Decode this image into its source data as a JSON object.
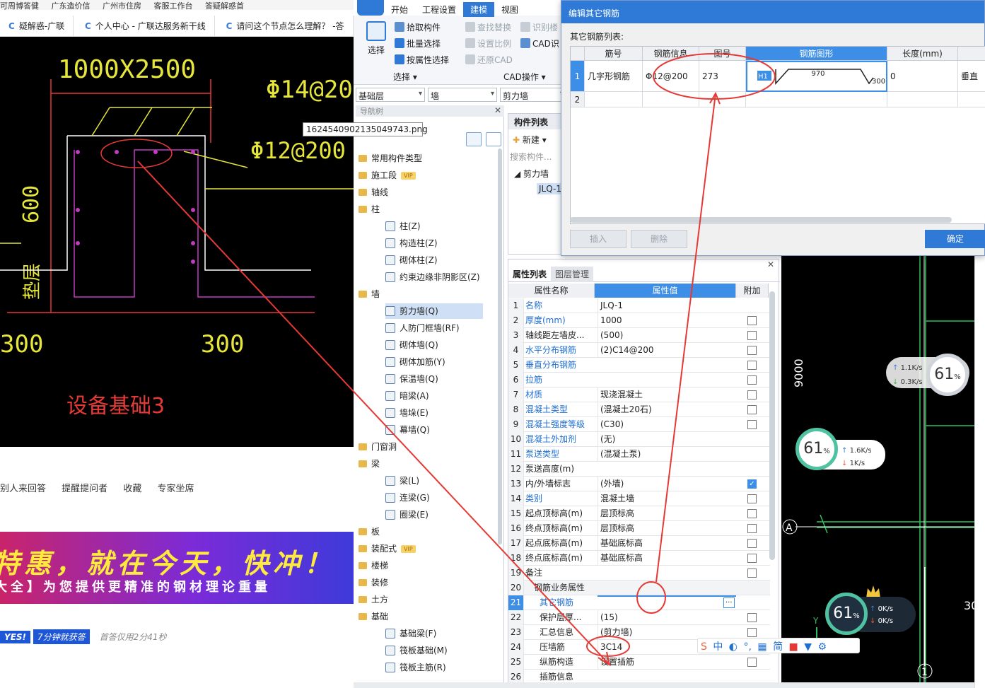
{
  "browser": {
    "bookmarks": [
      "可周博答健",
      "广东造价信",
      "广州市住房",
      "客服工作台",
      "答疑解惑首"
    ],
    "tabs": [
      "疑解惑-广联",
      "个人中心 - 广联达服务新干线",
      "请问这个节点怎么理解？ -答"
    ],
    "image_tooltip": "1624540902135049743.png",
    "qa_actions": [
      "别人来回答",
      "提醒提问者",
      "收藏",
      "专家坐席"
    ],
    "banner_line1": "特惠，就在今天，快冲！",
    "banner_line2": "大全】为您提供更精准的钢材理论重量",
    "promo_yes": "YES!",
    "promo_fast": "7分钟就获答",
    "promo_note": "首答仅用2分41秒"
  },
  "cad_left": {
    "dim_top": "1000X2500",
    "rebar_top": "Φ14@200",
    "rebar_mid": "Φ12@200",
    "dim_side": "600",
    "dim_bottom_left": "300",
    "dim_bottom_right": "300",
    "title": "设备基础3",
    "side_label": "垫层"
  },
  "app": {
    "ribbon_tabs": [
      "开始",
      "工程设置",
      "建模",
      "视图"
    ],
    "active_tab": "建模",
    "select_big": "选择",
    "buttons": [
      "拾取构件",
      "批量选择",
      "按属性选择"
    ],
    "cad_buttons": [
      "查找替换",
      "设置比例",
      "还原CAD",
      "识别楼",
      "CAD识"
    ],
    "group_select": "选择",
    "group_cad": "CAD操作",
    "dd_floor": "基础层",
    "dd_type": "墙",
    "dd_sub": "剪力墙"
  },
  "nav": {
    "header": "导航树",
    "items": [
      {
        "label": "常用构件类型",
        "kind": "folder"
      },
      {
        "label": "施工段",
        "kind": "folder",
        "vip": "VIP"
      },
      {
        "label": "轴线",
        "kind": "folder"
      },
      {
        "label": "柱",
        "kind": "folder"
      },
      {
        "label": "柱(Z)",
        "kind": "comp"
      },
      {
        "label": "构造柱(Z)",
        "kind": "comp"
      },
      {
        "label": "砌体柱(Z)",
        "kind": "comp"
      },
      {
        "label": "约束边缘非阴影区(Z)",
        "kind": "comp"
      },
      {
        "label": "墙",
        "kind": "folder"
      },
      {
        "label": "剪力墙(Q)",
        "kind": "comp",
        "selected": true
      },
      {
        "label": "人防门框墙(RF)",
        "kind": "comp"
      },
      {
        "label": "砌体墙(Q)",
        "kind": "comp"
      },
      {
        "label": "砌体加筋(Y)",
        "kind": "comp"
      },
      {
        "label": "保温墙(Q)",
        "kind": "comp"
      },
      {
        "label": "暗梁(A)",
        "kind": "comp"
      },
      {
        "label": "墙垛(E)",
        "kind": "comp"
      },
      {
        "label": "幕墙(Q)",
        "kind": "comp"
      },
      {
        "label": "门窗洞",
        "kind": "folder"
      },
      {
        "label": "梁",
        "kind": "folder"
      },
      {
        "label": "梁(L)",
        "kind": "comp"
      },
      {
        "label": "连梁(G)",
        "kind": "comp"
      },
      {
        "label": "圈梁(E)",
        "kind": "comp"
      },
      {
        "label": "板",
        "kind": "folder"
      },
      {
        "label": "装配式",
        "kind": "folder",
        "vip": "VIP"
      },
      {
        "label": "楼梯",
        "kind": "folder"
      },
      {
        "label": "装修",
        "kind": "folder"
      },
      {
        "label": "土方",
        "kind": "folder"
      },
      {
        "label": "基础",
        "kind": "folder"
      },
      {
        "label": "基础梁(F)",
        "kind": "comp"
      },
      {
        "label": "筏板基础(M)",
        "kind": "comp"
      },
      {
        "label": "筏板主筋(R)",
        "kind": "comp"
      }
    ]
  },
  "comp_list": {
    "tab": "构件列表",
    "new_btn": "新建",
    "search_placeholder": "搜索构件...",
    "tree_group": "剪力墙",
    "tree_item": "JLQ-1"
  },
  "dialog": {
    "title": "编辑其它钢筋",
    "list_label": "其它钢筋列表:",
    "headers": [
      "筋号",
      "钢筋信息",
      "图号",
      "钢筋图形",
      "长度(mm)"
    ],
    "row1": {
      "num": "1",
      "name": "几字形钢筋",
      "info": "Φ12@200",
      "fig": "273",
      "h1": "H1",
      "dim_a": "970",
      "dim_b": "300",
      "length": "0",
      "extra": "垂直"
    },
    "row2": {
      "num": "2"
    },
    "btn_insert": "插入",
    "btn_delete": "删除",
    "btn_ok": "确定"
  },
  "props": {
    "tabs": [
      "属性列表",
      "图层管理"
    ],
    "headers": [
      "属性名称",
      "属性值",
      "附加"
    ],
    "rows": [
      {
        "n": "1",
        "k": "名称",
        "v": "JLQ-1",
        "blue": true,
        "check": null
      },
      {
        "n": "2",
        "k": "厚度(mm)",
        "v": "1000",
        "blue": true,
        "check": false
      },
      {
        "n": "3",
        "k": "轴线距左墙皮...",
        "v": "(500)",
        "blue": false,
        "check": false
      },
      {
        "n": "4",
        "k": "水平分布钢筋",
        "v": "(2)C14@200",
        "blue": true,
        "check": false
      },
      {
        "n": "5",
        "k": "垂直分布钢筋",
        "v": "",
        "blue": true,
        "check": false
      },
      {
        "n": "6",
        "k": "拉筋",
        "v": "",
        "blue": true,
        "check": false
      },
      {
        "n": "7",
        "k": "材质",
        "v": "现浇混凝土",
        "blue": true,
        "check": false
      },
      {
        "n": "8",
        "k": "混凝土类型",
        "v": "(混凝土20石)",
        "blue": true,
        "check": false
      },
      {
        "n": "9",
        "k": "混凝土强度等级",
        "v": "(C30)",
        "blue": true,
        "check": false
      },
      {
        "n": "10",
        "k": "混凝土外加剂",
        "v": "(无)",
        "blue": true,
        "check": null
      },
      {
        "n": "11",
        "k": "泵送类型",
        "v": "(混凝土泵)",
        "blue": true,
        "check": null
      },
      {
        "n": "12",
        "k": "泵送高度(m)",
        "v": "",
        "blue": false,
        "check": null
      },
      {
        "n": "13",
        "k": "内/外墙标志",
        "v": "(外墙)",
        "blue": false,
        "check": true
      },
      {
        "n": "14",
        "k": "类别",
        "v": "混凝土墙",
        "blue": true,
        "check": false
      },
      {
        "n": "15",
        "k": "起点顶标高(m)",
        "v": "层顶标高",
        "blue": false,
        "check": false
      },
      {
        "n": "16",
        "k": "终点顶标高(m)",
        "v": "层顶标高",
        "blue": false,
        "check": false
      },
      {
        "n": "17",
        "k": "起点底标高(m)",
        "v": "基础底标高",
        "blue": false,
        "check": false
      },
      {
        "n": "18",
        "k": "终点底标高(m)",
        "v": "基础底标高",
        "blue": false,
        "check": false
      },
      {
        "n": "19",
        "k": "备注",
        "v": "",
        "blue": false,
        "check": false
      },
      {
        "n": "20",
        "k": "钢筋业务属性",
        "v": "",
        "blue": false,
        "check": null,
        "group": true
      },
      {
        "n": "21",
        "k": "其它钢筋",
        "v": "",
        "blue": true,
        "check": null,
        "active": true
      },
      {
        "n": "22",
        "k": "保护层厚...",
        "v": "(15)",
        "blue": false,
        "check": false
      },
      {
        "n": "23",
        "k": "汇总信息",
        "v": "(剪力墙)",
        "blue": false,
        "check": false
      },
      {
        "n": "24",
        "k": "压墙筋",
        "v": "3C14",
        "blue": false,
        "check": null
      },
      {
        "n": "25",
        "k": "纵筋构造",
        "v": "设置插筋",
        "blue": false,
        "check": false
      },
      {
        "n": "26",
        "k": "插筋信息",
        "v": "",
        "blue": false,
        "check": null
      }
    ]
  },
  "cad_right": {
    "dim_label": "9000",
    "axis_a": "A",
    "axis_1": "1",
    "axis_partial": "30",
    "y_label": "Y"
  },
  "gauges": [
    {
      "pct": "61",
      "up": "1.1K/s",
      "down": "0.3K/s"
    },
    {
      "pct": "61",
      "up": "1.6K/s",
      "down": "1K/s"
    },
    {
      "pct": "61",
      "up": "0K/s",
      "down": "0K/s"
    }
  ],
  "ime": {
    "chars": [
      "中",
      "简"
    ]
  },
  "colors": {
    "accent": "#2e7ad6",
    "annotation_red": "#e53935",
    "cad_yellow": "#e5e53a",
    "cad_magenta": "#c23ac2"
  }
}
